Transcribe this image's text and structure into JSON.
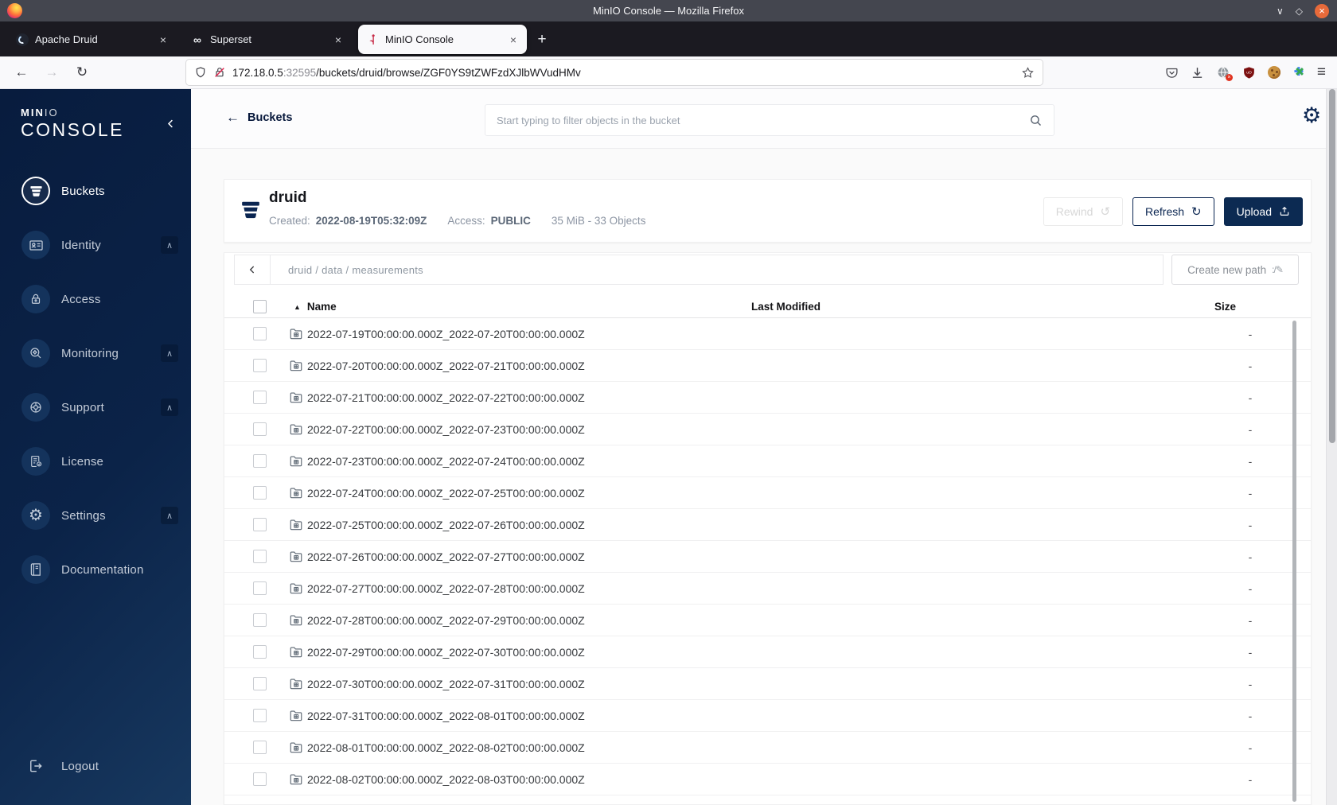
{
  "window": {
    "title": "MinIO Console — Mozilla Firefox"
  },
  "tabs": [
    {
      "label": "Apache Druid"
    },
    {
      "label": "Superset"
    },
    {
      "label": "MinIO Console"
    }
  ],
  "toolbar": {
    "url_host": "172.18.0.5",
    "url_port": ":32595",
    "url_path": "/buckets/druid/browse/ZGF0YS9tZWFzdXJlbWVudHMv"
  },
  "sidebar": {
    "logo_bold": "MIN",
    "logo_light": "IO",
    "logo_console": "CONSOLE",
    "items": [
      {
        "label": "Buckets"
      },
      {
        "label": "Identity"
      },
      {
        "label": "Access"
      },
      {
        "label": "Monitoring"
      },
      {
        "label": "Support"
      },
      {
        "label": "License"
      },
      {
        "label": "Settings"
      },
      {
        "label": "Documentation"
      }
    ],
    "logout_label": "Logout"
  },
  "header": {
    "back_label": "Buckets",
    "search_placeholder": "Start typing to filter objects in the bucket"
  },
  "bucket": {
    "name": "druid",
    "created_label": "Created:",
    "created_value": "2022-08-19T05:32:09Z",
    "access_label": "Access:",
    "access_value": "PUBLIC",
    "summary": "35 MiB - 33 Objects",
    "rewind_label": "Rewind",
    "refresh_label": "Refresh",
    "upload_label": "Upload"
  },
  "browse": {
    "breadcrumb": "druid / data / measurements",
    "create_path_label": "Create new path",
    "columns": {
      "name": "Name",
      "modified": "Last Modified",
      "size": "Size"
    },
    "rows": [
      {
        "name": "2022-07-19T00:00:00.000Z_2022-07-20T00:00:00.000Z",
        "size": "-"
      },
      {
        "name": "2022-07-20T00:00:00.000Z_2022-07-21T00:00:00.000Z",
        "size": "-"
      },
      {
        "name": "2022-07-21T00:00:00.000Z_2022-07-22T00:00:00.000Z",
        "size": "-"
      },
      {
        "name": "2022-07-22T00:00:00.000Z_2022-07-23T00:00:00.000Z",
        "size": "-"
      },
      {
        "name": "2022-07-23T00:00:00.000Z_2022-07-24T00:00:00.000Z",
        "size": "-"
      },
      {
        "name": "2022-07-24T00:00:00.000Z_2022-07-25T00:00:00.000Z",
        "size": "-"
      },
      {
        "name": "2022-07-25T00:00:00.000Z_2022-07-26T00:00:00.000Z",
        "size": "-"
      },
      {
        "name": "2022-07-26T00:00:00.000Z_2022-07-27T00:00:00.000Z",
        "size": "-"
      },
      {
        "name": "2022-07-27T00:00:00.000Z_2022-07-28T00:00:00.000Z",
        "size": "-"
      },
      {
        "name": "2022-07-28T00:00:00.000Z_2022-07-29T00:00:00.000Z",
        "size": "-"
      },
      {
        "name": "2022-07-29T00:00:00.000Z_2022-07-30T00:00:00.000Z",
        "size": "-"
      },
      {
        "name": "2022-07-30T00:00:00.000Z_2022-07-31T00:00:00.000Z",
        "size": "-"
      },
      {
        "name": "2022-07-31T00:00:00.000Z_2022-08-01T00:00:00.000Z",
        "size": "-"
      },
      {
        "name": "2022-08-01T00:00:00.000Z_2022-08-02T00:00:00.000Z",
        "size": "-"
      },
      {
        "name": "2022-08-02T00:00:00.000Z_2022-08-03T00:00:00.000Z",
        "size": "-"
      }
    ]
  },
  "icons": {
    "close_x": "×",
    "plus": "+",
    "window_min": "∨",
    "window_max": "◇",
    "back_arrow": "←",
    "forward_arrow": "→",
    "reload": "↻",
    "hamburger": "≡",
    "superset_infinity": "∞",
    "gear": "⚙",
    "rewind": "↺",
    "refresh": "↻",
    "sort_asc": "▲",
    "chevron_up": "∧",
    "path_glyph": ":/",
    "pencil": "✎",
    "globe_badge_x": "×"
  },
  "colors": {
    "navy": "#0a2551",
    "upload_button": "#0c2a52",
    "sidebar_gradient_start": "#081c3e",
    "sidebar_gradient_end": "#17385f",
    "minio_red": "#c72c48",
    "active_tab_bg": "#f9f9fb"
  }
}
